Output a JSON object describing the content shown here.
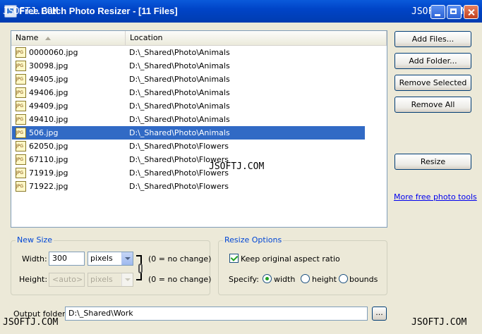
{
  "window": {
    "title": "Free Batch Photo Resizer - [11 Files]",
    "watermark": "JSOFTJ.COM"
  },
  "filelist": {
    "columns": {
      "name": "Name",
      "location": "Location"
    },
    "rows": [
      {
        "name": "0000060.jpg",
        "location": "D:\\_Shared\\Photo\\Animals"
      },
      {
        "name": "30098.jpg",
        "location": "D:\\_Shared\\Photo\\Animals"
      },
      {
        "name": "49405.jpg",
        "location": "D:\\_Shared\\Photo\\Animals"
      },
      {
        "name": "49406.jpg",
        "location": "D:\\_Shared\\Photo\\Animals"
      },
      {
        "name": "49409.jpg",
        "location": "D:\\_Shared\\Photo\\Animals"
      },
      {
        "name": "49410.jpg",
        "location": "D:\\_Shared\\Photo\\Animals"
      },
      {
        "name": "506.jpg",
        "location": "D:\\_Shared\\Photo\\Animals",
        "selected": true
      },
      {
        "name": "62050.jpg",
        "location": "D:\\_Shared\\Photo\\Flowers"
      },
      {
        "name": "67110.jpg",
        "location": "D:\\_Shared\\Photo\\Flowers"
      },
      {
        "name": "71919.jpg",
        "location": "D:\\_Shared\\Photo\\Flowers"
      },
      {
        "name": "71922.jpg",
        "location": "D:\\_Shared\\Photo\\Flowers"
      }
    ]
  },
  "buttons": {
    "add_files": "Add Files...",
    "add_folder": "Add Folder...",
    "remove_selected": "Remove Selected",
    "remove_all": "Remove All",
    "resize": "Resize",
    "browse": "..."
  },
  "more_tools_link": "More free photo tools",
  "new_size": {
    "title": "New Size",
    "width_label": "Width:",
    "width_value": "300",
    "width_unit": "pixels",
    "height_label": "Height:",
    "height_value": "<auto>",
    "height_unit": "pixels",
    "width_hint": "(0 = no change)",
    "height_hint": "(0 = no change)"
  },
  "resize_options": {
    "title": "Resize Options",
    "keep_aspect_label": "Keep original aspect ratio",
    "keep_aspect_checked": true,
    "specify_label": "Specify:",
    "options": [
      "width",
      "height",
      "bounds"
    ],
    "selected": "width"
  },
  "output": {
    "label": "Output folder:",
    "value": "D:\\_Shared\\Work"
  }
}
